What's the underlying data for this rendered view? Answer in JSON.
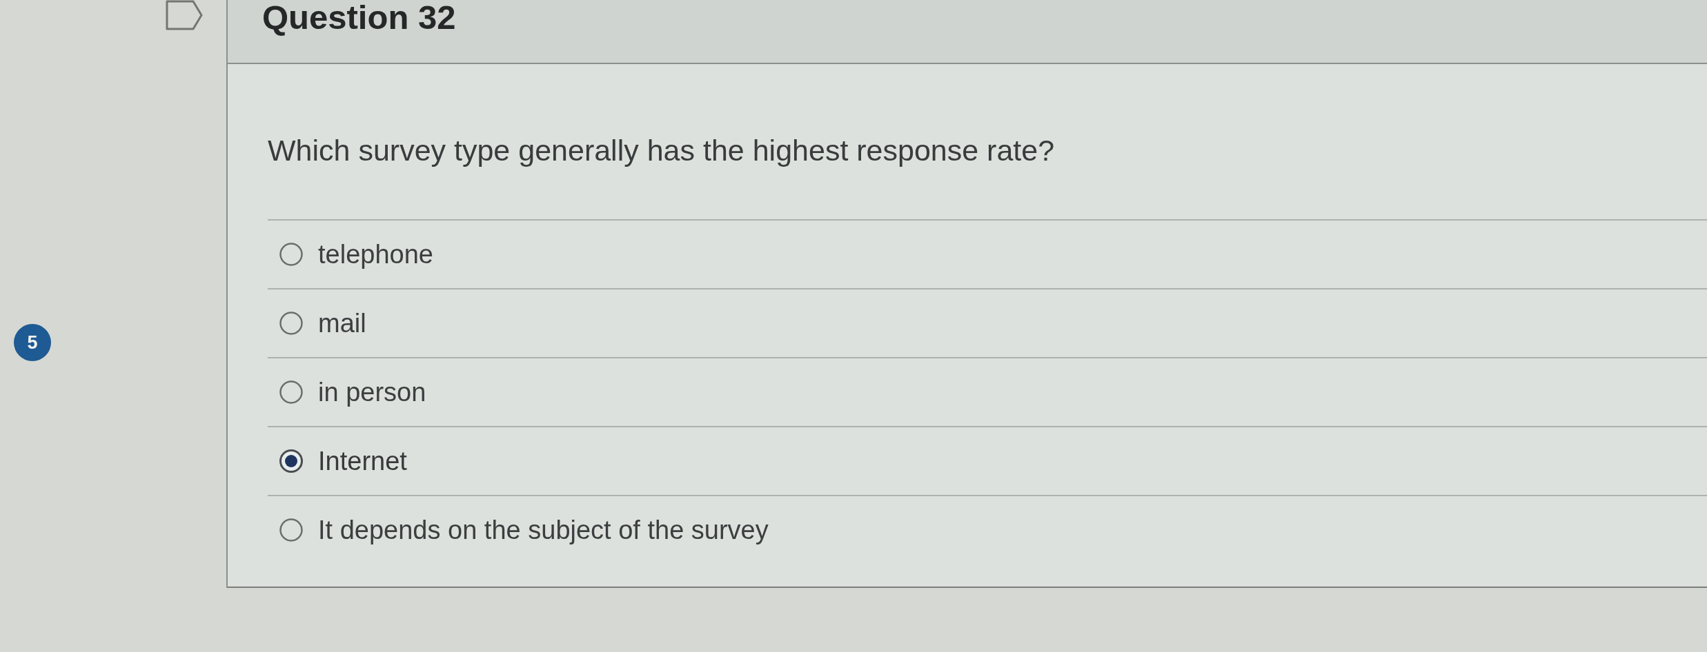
{
  "sidebar": {
    "badge": "5"
  },
  "question": {
    "flagged": false,
    "title": "Question 32",
    "text": "Which survey type generally has the highest response rate?",
    "options": [
      {
        "label": "telephone",
        "selected": false
      },
      {
        "label": "mail",
        "selected": false
      },
      {
        "label": "in person",
        "selected": false
      },
      {
        "label": "Internet",
        "selected": true
      },
      {
        "label": "It depends on the subject of the survey",
        "selected": false
      }
    ]
  }
}
